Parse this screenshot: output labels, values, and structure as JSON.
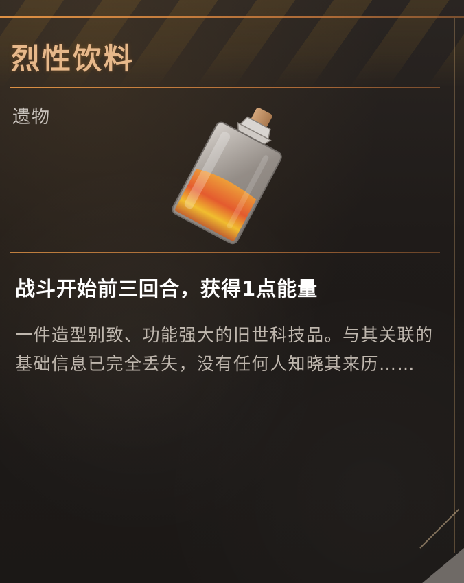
{
  "item": {
    "name": "烈性饮料",
    "category": "遗物",
    "effect": "战斗开始前三回合，获得1点能量",
    "description": "一件造型别致、功能强大的旧世科技品。与其关联的基础信息已完全丢失，没有任何人知晓其来历……",
    "image_icon": "liquor-bottle-icon"
  },
  "colors": {
    "accent": "#e7a463",
    "title": "#e7b88a",
    "effect_text": "#ffffff",
    "description_text": "#bfb7ae",
    "background": "#1f1b19"
  }
}
